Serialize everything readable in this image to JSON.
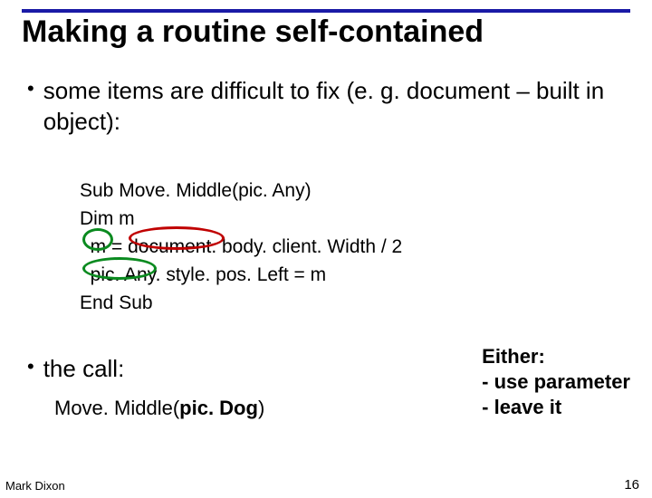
{
  "title": "Making a routine self-contained",
  "bullets": {
    "b1": "some items are difficult to fix (e. g. document – built in object):",
    "b2": "the call:"
  },
  "code": {
    "l1": "Sub Move. Middle(pic. Any)",
    "l2": "Dim m",
    "l3": "  m = document. body. client. Width / 2",
    "l4": "  pic. Any. style. pos. Left = m",
    "l5": "End Sub"
  },
  "callcode": {
    "prefix": "Move. Middle(",
    "arg": "pic. Dog",
    "suffix": ")"
  },
  "note": {
    "l1": "Either:",
    "l2": " - use parameter",
    "l3": " - leave it"
  },
  "footer": {
    "author": "Mark Dixon",
    "page": "16"
  }
}
